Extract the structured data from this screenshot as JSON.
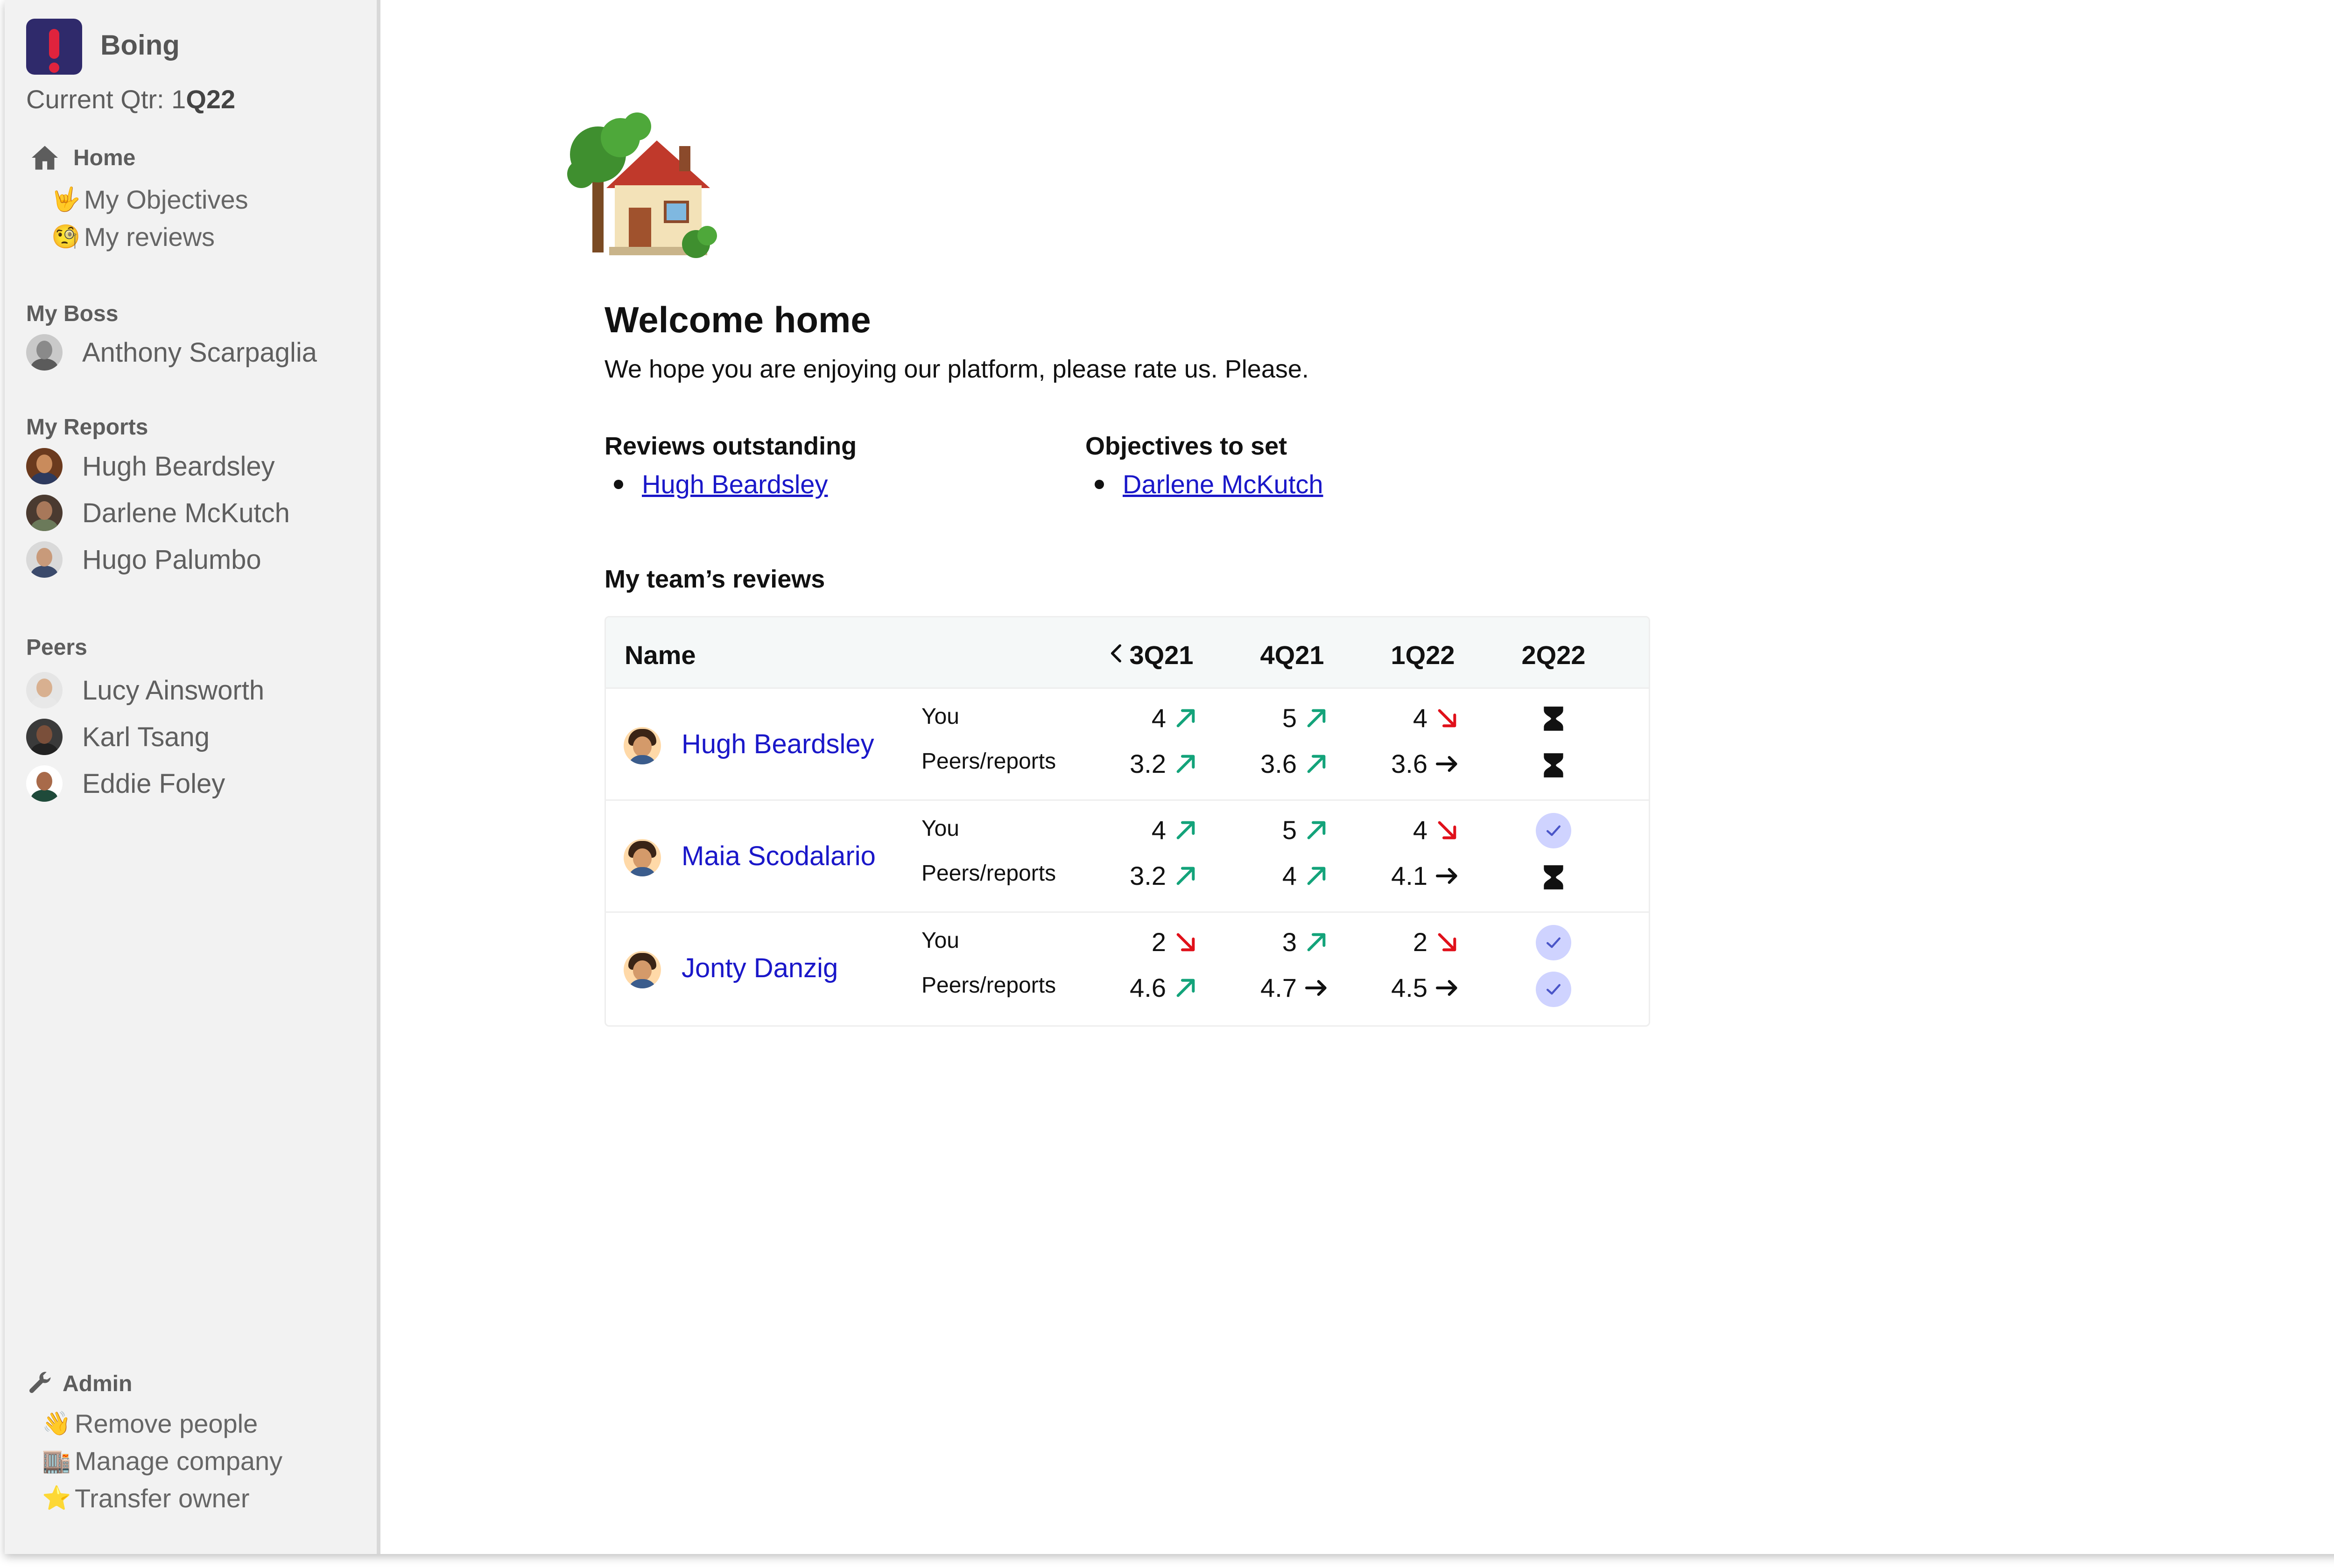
{
  "app": {
    "name": "Boing",
    "current_qtr_label": "Current Qtr: ",
    "current_qtr_prefix": "1",
    "current_qtr_bold": "Q22"
  },
  "nav": {
    "home_label": "Home",
    "items": [
      {
        "emoji": "🤟",
        "label": "My Objectives"
      },
      {
        "emoji": "🧐",
        "label": "My reviews"
      }
    ]
  },
  "boss": {
    "heading": "My Boss",
    "people": [
      {
        "name": "Anthony Scarpaglia"
      }
    ]
  },
  "reports": {
    "heading": "My Reports",
    "people": [
      {
        "name": "Hugh Beardsley"
      },
      {
        "name": "Darlene McKutch"
      },
      {
        "name": "Hugo Palumbo"
      }
    ]
  },
  "peers": {
    "heading": "Peers",
    "people": [
      {
        "name": "Lucy Ainsworth"
      },
      {
        "name": "Karl Tsang"
      },
      {
        "name": "Eddie Foley"
      }
    ]
  },
  "admin": {
    "heading": "Admin",
    "items": [
      {
        "emoji": "👋",
        "label": "Remove people"
      },
      {
        "emoji": "🏬",
        "label": "Manage company"
      },
      {
        "emoji": "⭐",
        "label": "Transfer owner"
      }
    ]
  },
  "welcome": {
    "title": "Welcome home",
    "subtitle": "We hope you are enjoying our platform, please rate us. Please."
  },
  "todos": {
    "reviews_heading": "Reviews outstanding",
    "reviews_items": [
      "Hugh Beardsley"
    ],
    "objectives_heading": "Objectives to set",
    "objectives_items": [
      "Darlene McKutch"
    ]
  },
  "team": {
    "title": "My team’s reviews",
    "columns": {
      "name": "Name",
      "quarters": [
        "3Q21",
        "4Q21",
        "1Q22",
        "2Q22"
      ]
    },
    "row_labels": {
      "you": "You",
      "peers": "Peers/reports"
    },
    "rows": [
      {
        "name": "Hugh Beardsley",
        "you": [
          {
            "v": "4",
            "trend": "up"
          },
          {
            "v": "5",
            "trend": "up"
          },
          {
            "v": "4",
            "trend": "down"
          }
        ],
        "peers": [
          {
            "v": "3.2",
            "trend": "up"
          },
          {
            "v": "3.6",
            "trend": "up"
          },
          {
            "v": "3.6",
            "trend": "flat"
          }
        ],
        "status_you": "pending",
        "status_peers": "pending"
      },
      {
        "name": "Maia Scodalario",
        "you": [
          {
            "v": "4",
            "trend": "up"
          },
          {
            "v": "5",
            "trend": "up"
          },
          {
            "v": "4",
            "trend": "down"
          }
        ],
        "peers": [
          {
            "v": "3.2",
            "trend": "up"
          },
          {
            "v": "4",
            "trend": "up"
          },
          {
            "v": "4.1",
            "trend": "flat"
          }
        ],
        "status_you": "done",
        "status_peers": "pending"
      },
      {
        "name": "Jonty Danzig",
        "you": [
          {
            "v": "2",
            "trend": "down"
          },
          {
            "v": "3",
            "trend": "up"
          },
          {
            "v": "2",
            "trend": "down"
          }
        ],
        "peers": [
          {
            "v": "4.6",
            "trend": "up"
          },
          {
            "v": "4.7",
            "trend": "flat"
          },
          {
            "v": "4.5",
            "trend": "flat"
          }
        ],
        "status_you": "done",
        "status_peers": "done"
      }
    ]
  },
  "colors": {
    "up": "#13a37a",
    "down": "#e0101a",
    "flat": "#111111",
    "link": "#1a17c9",
    "check_bg": "#cfd3ff",
    "check": "#4a55c8"
  },
  "icons": {
    "home": "home-icon",
    "admin": "wrench-icon",
    "hero": "house-with-tree-icon",
    "pending": "hourglass-icon",
    "done": "check-icon",
    "collapse": "chevron-left-icon"
  }
}
